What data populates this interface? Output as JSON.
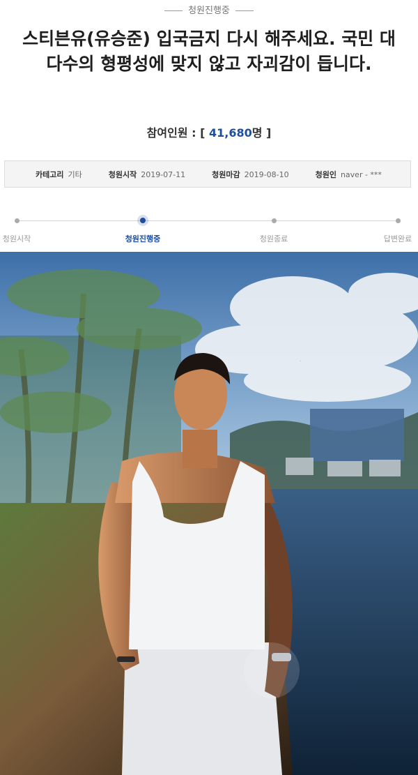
{
  "status_tag": "청원진행중",
  "title": "스티븐유(유승준) 입국금지 다시 해주세요. 국민 대다수의 형평성에 맞지 않고 자괴감이 듭니다.",
  "participants": {
    "label": "참여인원 : [",
    "count": "41,680",
    "suffix": "명 ]"
  },
  "meta": {
    "category_label": "카테고리",
    "category_value": "기타",
    "start_label": "청원시작",
    "start_value": "2019-07-11",
    "end_label": "청원마감",
    "end_value": "2019-08-10",
    "author_label": "청원인",
    "author_value": "naver - ***"
  },
  "steps": [
    {
      "label": "청원시작",
      "active": false
    },
    {
      "label": "청원진행중",
      "active": true
    },
    {
      "label": "청원종료",
      "active": false
    },
    {
      "label": "답변완료",
      "active": false
    }
  ],
  "colors": {
    "accent": "#1f4e9c",
    "muted": "#999999"
  }
}
